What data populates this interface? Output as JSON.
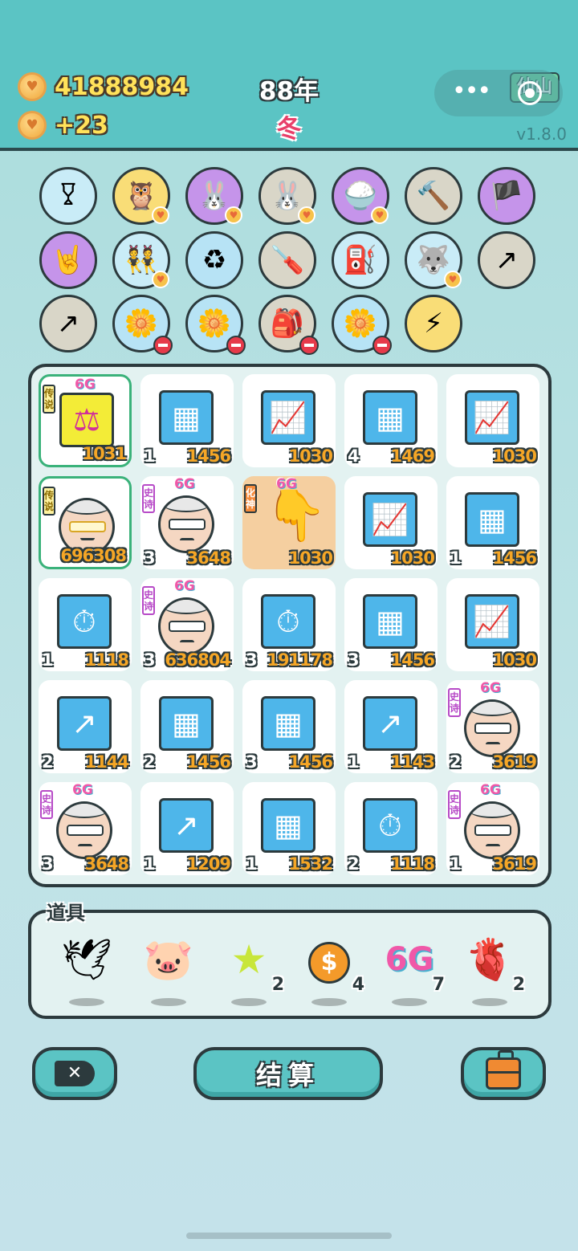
{
  "header": {
    "coins": "41888984",
    "coin_rate": "+23",
    "year": "88年",
    "season": "冬",
    "return_label": "仙山",
    "version": "v1.8.0"
  },
  "shelf": {
    "row1": [
      "skirt-icon",
      "owl-masks-icon",
      "rabbit-icon",
      "rabbit-icon",
      "rice-bowl-icon",
      "hammer-icon",
      "eyepatch-icon"
    ],
    "row2": [
      "rock-hand-icon",
      "twins-icon",
      "recycle-bag-icon",
      "screwdriver-icon",
      "air-pump-icon",
      "husky-icon",
      "boost-card-icon"
    ],
    "row3": [
      "boost-card-icon",
      "flower-pot-icon",
      "flower-pot-icon",
      "seed-bag-icon",
      "flower-pot-icon",
      "lightning-icon"
    ]
  },
  "grid": [
    {
      "icon": "scale-icon",
      "badge": "传说",
      "tag": "6G",
      "count": "",
      "value": "1031"
    },
    {
      "icon": "gold-bars-icon",
      "badge": "",
      "tag": "",
      "count": "1",
      "value": "1456"
    },
    {
      "icon": "growth-chart-icon",
      "badge": "",
      "tag": "",
      "count": "",
      "value": "1030"
    },
    {
      "icon": "gold-bars-icon",
      "badge": "",
      "tag": "",
      "count": "4",
      "value": "1469"
    },
    {
      "icon": "growth-chart-icon",
      "badge": "",
      "tag": "",
      "count": "",
      "value": "1030"
    },
    {
      "icon": "old-man-gold-icon",
      "badge": "传说",
      "tag": "",
      "count": "",
      "value": "696308"
    },
    {
      "icon": "old-man-icon",
      "badge": "史诗",
      "tag": "6G",
      "count": "3",
      "value": "3648"
    },
    {
      "icon": "pointing-hand-icon",
      "badge": "化神",
      "tag": "6G",
      "count": "",
      "value": "1030"
    },
    {
      "icon": "growth-chart-icon",
      "badge": "",
      "tag": "",
      "count": "",
      "value": "1030"
    },
    {
      "icon": "gold-bars-icon",
      "badge": "",
      "tag": "",
      "count": "1",
      "value": "1456"
    },
    {
      "icon": "stopwatch-icon",
      "badge": "",
      "tag": "",
      "count": "1",
      "value": "1118"
    },
    {
      "icon": "old-man-icon",
      "badge": "史诗",
      "tag": "6G",
      "count": "3",
      "value": "636804"
    },
    {
      "icon": "stopwatch-icon",
      "badge": "",
      "tag": "",
      "count": "3",
      "value": "191178"
    },
    {
      "icon": "gold-bars-icon",
      "badge": "",
      "tag": "",
      "count": "3",
      "value": "1456"
    },
    {
      "icon": "growth-chart-icon",
      "badge": "",
      "tag": "",
      "count": "",
      "value": "1030"
    },
    {
      "icon": "trend-icon",
      "badge": "",
      "tag": "",
      "count": "2",
      "value": "1144"
    },
    {
      "icon": "gold-bars-icon",
      "badge": "",
      "tag": "",
      "count": "2",
      "value": "1456"
    },
    {
      "icon": "gold-bars-icon",
      "badge": "",
      "tag": "",
      "count": "3",
      "value": "1456"
    },
    {
      "icon": "trend-icon",
      "badge": "",
      "tag": "",
      "count": "1",
      "value": "1143"
    },
    {
      "icon": "old-man-icon",
      "badge": "史诗",
      "tag": "6G",
      "count": "2",
      "value": "3619"
    },
    {
      "icon": "old-man-icon",
      "badge": "史诗",
      "tag": "6G",
      "count": "3",
      "value": "3648"
    },
    {
      "icon": "trend-icon",
      "badge": "",
      "tag": "",
      "count": "1",
      "value": "1209"
    },
    {
      "icon": "gold-bars-icon",
      "badge": "",
      "tag": "",
      "count": "1",
      "value": "1532"
    },
    {
      "icon": "stopwatch-icon",
      "badge": "",
      "tag": "",
      "count": "2",
      "value": "1118"
    },
    {
      "icon": "old-man-icon",
      "badge": "史诗",
      "tag": "6G",
      "count": "1",
      "value": "3619"
    }
  ],
  "props": {
    "title": "道具",
    "items": [
      {
        "icon": "dove-icon",
        "qty": ""
      },
      {
        "icon": "piggy-bank-icon",
        "qty": ""
      },
      {
        "icon": "star-icon",
        "qty": "2"
      },
      {
        "icon": "coin-icon",
        "qty": "4"
      },
      {
        "icon": "6g-icon",
        "qty": "7",
        "label": "6G"
      },
      {
        "icon": "liver-icon",
        "qty": "2"
      }
    ]
  },
  "buttons": {
    "settle": "结算"
  }
}
